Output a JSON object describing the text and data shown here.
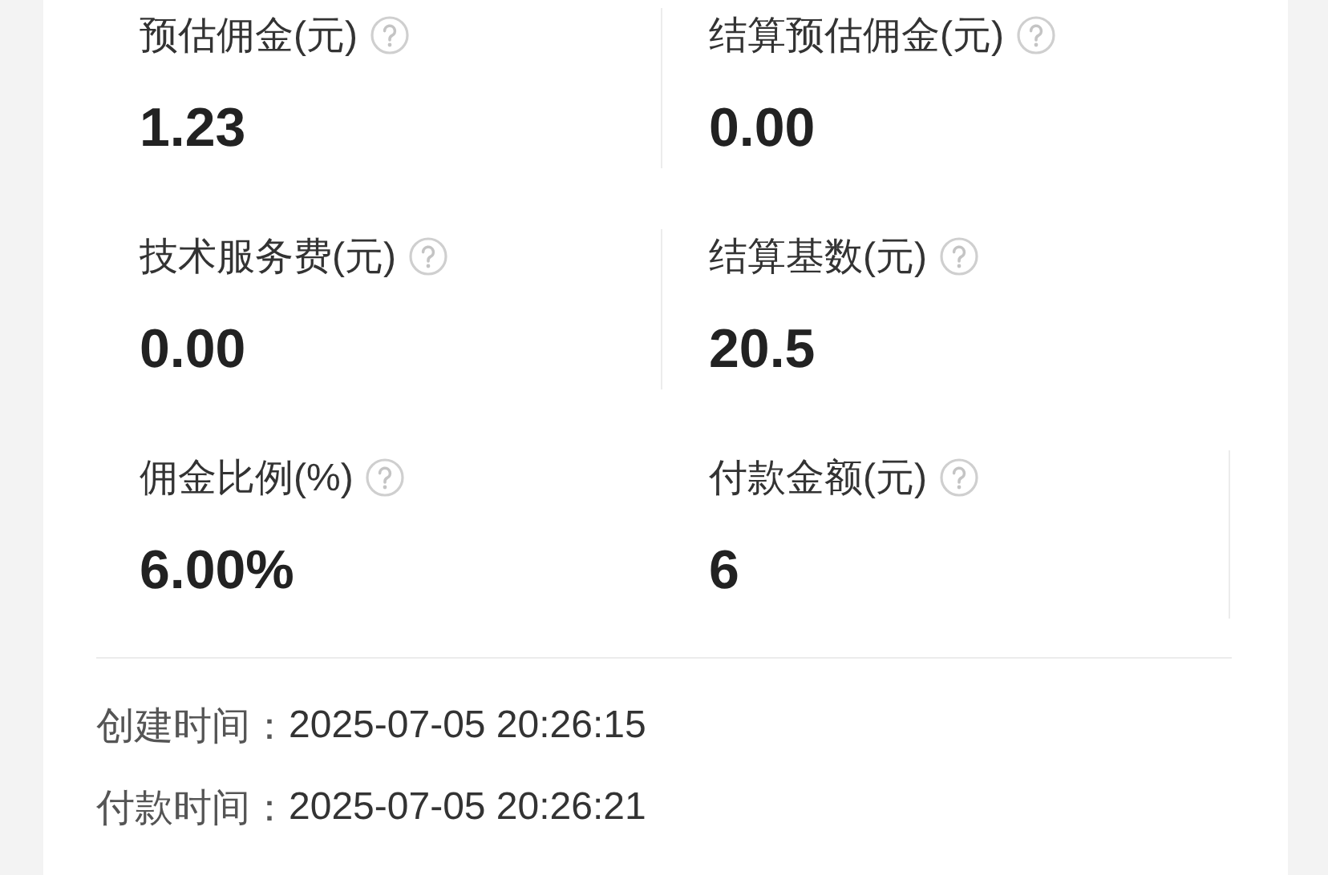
{
  "metrics": [
    {
      "label": "预估佣金(元)",
      "value": "1.23"
    },
    {
      "label": "结算预估佣金(元)",
      "value": "0.00"
    },
    {
      "label": "技术服务费(元)",
      "value": "0.00"
    },
    {
      "label": "结算基数(元)",
      "value": "20.5"
    },
    {
      "label": "佣金比例(%)",
      "value": "6.00%"
    },
    {
      "label": "付款金额(元)",
      "value": "6"
    }
  ],
  "times": [
    {
      "label": "创建时间：",
      "value": "2025-07-05 20:26:15"
    },
    {
      "label": "付款时间：",
      "value": "2025-07-05 20:26:21"
    }
  ]
}
